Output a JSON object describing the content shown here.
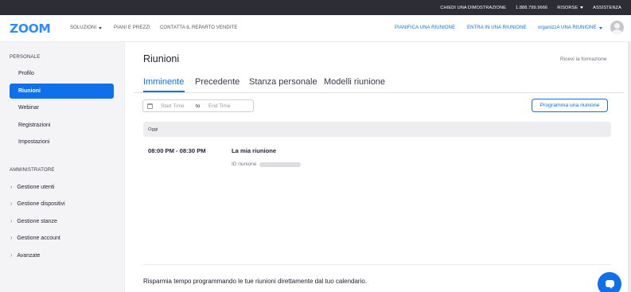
{
  "topbar": {
    "demo": "CHIEDI UNA DIMOSTRAZIONE",
    "phone": "1.888.799.9666",
    "resources": "RISORSE",
    "support": "ASSISTENZA"
  },
  "navbar": {
    "logo": "zoom",
    "solutions": "SOLUZIONI",
    "plans": "PIANI E PREZZI",
    "contact": "CONTATTA IL REPARTO VENDITE",
    "schedule": "PIANIFICA UNA RIUNIONE",
    "join": "ENTRA IN UNA RIUNIONE",
    "host": "organizzA UNA RIUNIONE"
  },
  "sidebar": {
    "personal_header": "PERSONALE",
    "personal_items": [
      "Profilo",
      "Riunioni",
      "Webinar",
      "Registrazioni",
      "Impostazioni"
    ],
    "admin_header": "AMMINISTRATORE",
    "admin_items": [
      "Gestione utenti",
      "Gestione dispositivi",
      "Gestione stanze",
      "Gestione account",
      "Avanzate"
    ]
  },
  "main": {
    "title": "Riunioni",
    "training": "Ricevi la formazione",
    "tabs": [
      "Imminente",
      "Precedente",
      "Stanza personale",
      "Modelli riunione"
    ],
    "date_start": "Start Time",
    "date_to": "to",
    "date_end": "End Time",
    "schedule_button": "Programma una riunione",
    "day_label": "Oggi",
    "meeting": {
      "time": "08:00 PM - 08:30 PM",
      "title": "La mia riunione",
      "id_label": "ID riunione"
    },
    "promo": "Risparmia tempo programmando le tue riunioni direttamente dal tuo calendario."
  },
  "colors": {
    "brand": "#2d8cff",
    "accent": "#0e71eb",
    "topbar": "#2d2d37"
  },
  "icons": [
    "calendar-icon",
    "chat-icon",
    "avatar-icon",
    "chevron-right-icon",
    "caret-down-icon"
  ]
}
